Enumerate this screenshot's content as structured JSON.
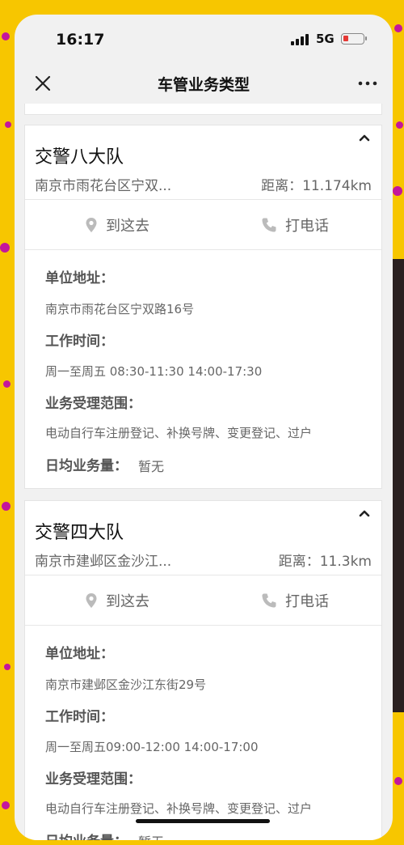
{
  "status_bar": {
    "time": "16:17",
    "network": "5G"
  },
  "nav": {
    "title": "车管业务类型"
  },
  "cards": [
    {
      "name": "交警八大队",
      "address_short": "南京市雨花台区宁双...",
      "distance": "距离：11.174km",
      "go_label": "到这去",
      "call_label": "打电话",
      "address_label": "单位地址：",
      "address": "南京市雨花台区宁双路16号",
      "hours_label": "工作时间：",
      "hours": "周一至周五 08:30-11:30 14:00-17:30",
      "scope_label": "业务受理范围：",
      "scope": "电动自行车注册登记、补换号牌、变更登记、过户",
      "volume_label": "日均业务量：",
      "volume": "暂无"
    },
    {
      "name": "交警四大队",
      "address_short": "南京市建邺区金沙江...",
      "distance": "距离：11.3km",
      "go_label": "到这去",
      "call_label": "打电话",
      "address_label": "单位地址：",
      "address": "南京市建邺区金沙江东街29号",
      "hours_label": "工作时间：",
      "hours": "周一至周五09:00-12:00 14:00-17:00",
      "scope_label": "业务受理范围：",
      "scope": "电动自行车注册登记、补换号牌、变更登记、过户",
      "volume_label": "日均业务量：",
      "volume": "暂无"
    }
  ],
  "colors": {
    "background": "#f7c600",
    "accent_dots": "#c4169c",
    "battery_low": "#e53935"
  }
}
